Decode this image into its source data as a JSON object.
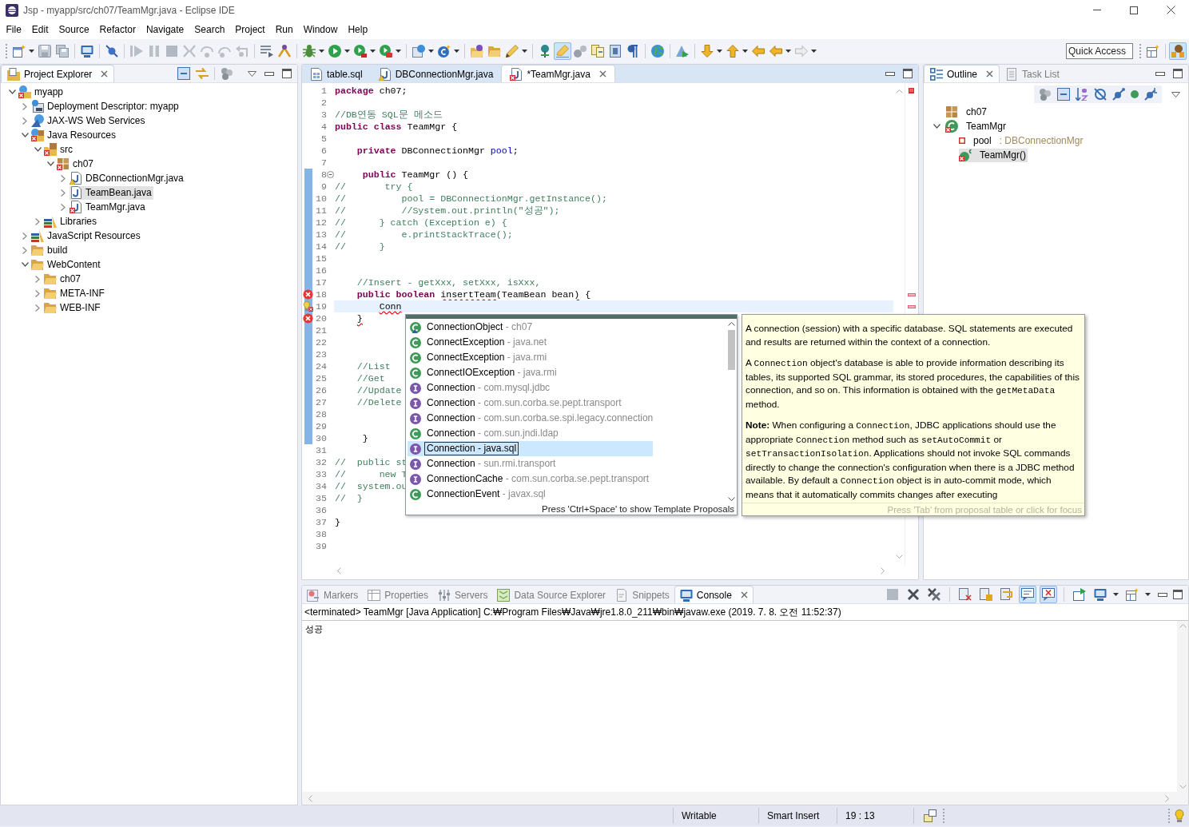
{
  "window": {
    "title": "Jsp - myapp/src/ch07/TeamMgr.java - Eclipse IDE"
  },
  "menu": [
    "File",
    "Edit",
    "Source",
    "Refactor",
    "Navigate",
    "Search",
    "Project",
    "Run",
    "Window",
    "Help"
  ],
  "main_toolbar": [
    {
      "kind": "new",
      "on": false,
      "menu": true
    },
    {
      "kind": "save",
      "on": false,
      "menu": false
    },
    {
      "kind": "save-all",
      "on": false,
      "menu": false
    },
    {
      "kind": "separator"
    },
    {
      "kind": "terminal",
      "on": false,
      "menu": false
    },
    {
      "kind": "separator"
    },
    {
      "kind": "skip-breakpoints",
      "on": false,
      "menu": false
    },
    {
      "kind": "separator"
    },
    {
      "kind": "resume",
      "on": false,
      "menu": false
    },
    {
      "kind": "suspend",
      "on": false,
      "menu": false
    },
    {
      "kind": "terminate",
      "on": false,
      "menu": false
    },
    {
      "kind": "disconnect",
      "on": false,
      "menu": false
    },
    {
      "kind": "step-into",
      "on": false,
      "menu": false
    },
    {
      "kind": "step-over",
      "on": false,
      "menu": false
    },
    {
      "kind": "step-return",
      "on": false,
      "menu": false
    },
    {
      "kind": "separator"
    },
    {
      "kind": "step-filters",
      "on": false,
      "menu": false
    },
    {
      "kind": "drop-to-frame",
      "on": false,
      "menu": false
    },
    {
      "kind": "separator"
    },
    {
      "kind": "debug",
      "on": false,
      "menu": true
    },
    {
      "kind": "run",
      "on": false,
      "menu": true
    },
    {
      "kind": "coverage",
      "on": false,
      "menu": true
    },
    {
      "kind": "external-tools",
      "on": false,
      "menu": true
    },
    {
      "kind": "separator"
    },
    {
      "kind": "new-server",
      "on": false,
      "menu": true
    },
    {
      "kind": "new-class",
      "on": false,
      "menu": true
    },
    {
      "kind": "separator"
    },
    {
      "kind": "open-type",
      "on": false,
      "menu": false
    },
    {
      "kind": "open-task",
      "on": false,
      "menu": false
    },
    {
      "kind": "ant",
      "on": false,
      "menu": true
    },
    {
      "kind": "separator"
    },
    {
      "kind": "pin",
      "on": false,
      "menu": false
    },
    {
      "kind": "mark-occurrences",
      "on": true,
      "menu": false
    },
    {
      "kind": "block-select",
      "on": false,
      "menu": false
    },
    {
      "kind": "compare",
      "on": false,
      "menu": false
    },
    {
      "kind": "document",
      "on": false,
      "menu": false
    },
    {
      "kind": "whitespace",
      "on": false,
      "menu": false
    },
    {
      "kind": "separator"
    },
    {
      "kind": "globe",
      "on": false,
      "menu": false
    },
    {
      "kind": "separator"
    },
    {
      "kind": "launch",
      "on": false,
      "menu": false
    },
    {
      "kind": "separator"
    },
    {
      "kind": "next-annotation",
      "on": false,
      "menu": true
    },
    {
      "kind": "prev-annotation",
      "on": false,
      "menu": true
    },
    {
      "kind": "last-edit",
      "on": false,
      "menu": false
    },
    {
      "kind": "back",
      "on": false,
      "menu": true
    },
    {
      "kind": "forward",
      "on": false,
      "menu": true
    }
  ],
  "quick_access": {
    "placeholder": "Quick Access"
  },
  "perspectives": [
    {
      "kind": "open-perspective",
      "on": false
    },
    {
      "kind": "java-ee",
      "on": true
    }
  ],
  "project_explorer": {
    "tabs": [
      {
        "label": "Project Explorer",
        "kind": "explorer",
        "selected": true
      }
    ],
    "tree": [
      {
        "label": "myapp",
        "kind": "project",
        "error": true,
        "warning": false,
        "expanded": true,
        "selected": false,
        "children": [
          {
            "label": "Deployment Descriptor: myapp",
            "kind": "descriptor",
            "error": false,
            "warning": false,
            "expanded": false,
            "selected": false
          },
          {
            "label": "JAX-WS Web Services",
            "kind": "webservices",
            "error": false,
            "warning": false,
            "expanded": false,
            "selected": false
          },
          {
            "label": "Java Resources",
            "kind": "java-resources",
            "error": true,
            "warning": false,
            "expanded": true,
            "selected": false,
            "children": [
              {
                "label": "src",
                "kind": "source-folder",
                "error": true,
                "warning": false,
                "expanded": true,
                "selected": false,
                "children": [
                  {
                    "label": "ch07",
                    "kind": "package",
                    "error": true,
                    "warning": false,
                    "expanded": true,
                    "selected": false,
                    "children": [
                      {
                        "label": "DBConnectionMgr.java",
                        "kind": "java-file",
                        "error": false,
                        "warning": true,
                        "expanded": false,
                        "selected": false
                      },
                      {
                        "label": "TeamBean.java",
                        "kind": "java-file",
                        "error": false,
                        "warning": false,
                        "expanded": false,
                        "selected": true
                      },
                      {
                        "label": "TeamMgr.java",
                        "kind": "java-file",
                        "error": true,
                        "warning": false,
                        "expanded": false,
                        "selected": false
                      }
                    ]
                  }
                ]
              },
              {
                "label": "Libraries",
                "kind": "library",
                "error": false,
                "warning": false,
                "expanded": false,
                "selected": false
              }
            ]
          },
          {
            "label": "JavaScript Resources",
            "kind": "library",
            "error": false,
            "warning": false,
            "expanded": false,
            "selected": false
          },
          {
            "label": "build",
            "kind": "folder",
            "error": false,
            "warning": false,
            "expanded": false,
            "selected": false
          },
          {
            "label": "WebContent",
            "kind": "folder",
            "error": false,
            "warning": false,
            "expanded": true,
            "selected": false,
            "children": [
              {
                "label": "ch07",
                "kind": "folder",
                "error": false,
                "warning": false,
                "expanded": false,
                "selected": false
              },
              {
                "label": "META-INF",
                "kind": "folder",
                "error": false,
                "warning": false,
                "expanded": false,
                "selected": false
              },
              {
                "label": "WEB-INF",
                "kind": "folder",
                "error": false,
                "warning": false,
                "expanded": false,
                "selected": false
              }
            ]
          }
        ]
      }
    ]
  },
  "editor": {
    "tabs": [
      {
        "label": "table.sql",
        "kind": "sql",
        "error": false,
        "warning": false,
        "selected": false
      },
      {
        "label": "DBConnectionMgr.java",
        "kind": "java-file",
        "error": false,
        "warning": true,
        "selected": false
      },
      {
        "label": "*TeamMgr.java",
        "kind": "java-file",
        "error": true,
        "warning": false,
        "selected": true
      }
    ],
    "lines": [
      {
        "number": "1",
        "kind": "plain",
        "current": false,
        "scope": false,
        "fold": false,
        "segments": [
          {
            "kind": "keyword",
            "text": "package"
          },
          {
            "kind": "plain",
            "text": " ch07;"
          }
        ]
      },
      {
        "number": "2",
        "kind": "plain",
        "current": false,
        "scope": false,
        "fold": false
      },
      {
        "number": "3",
        "kind": "plain",
        "current": false,
        "scope": false,
        "fold": false,
        "segments": [
          {
            "kind": "comment",
            "text": "//DB연동 SQL문 메소드"
          }
        ]
      },
      {
        "number": "4",
        "kind": "plain",
        "current": false,
        "scope": false,
        "fold": false,
        "segments": [
          {
            "kind": "keyword",
            "text": "public"
          },
          {
            "kind": "keyword",
            "text": " class"
          },
          {
            "kind": "plain",
            "text": " TeamMgr {"
          }
        ]
      },
      {
        "number": "5",
        "kind": "plain",
        "current": false,
        "scope": false,
        "fold": false
      },
      {
        "number": "6",
        "kind": "plain",
        "current": false,
        "scope": false,
        "fold": false,
        "segments": [
          {
            "kind": "keyword",
            "text": "    private"
          },
          {
            "kind": "plain",
            "text": " DBConnectionMgr "
          },
          {
            "kind": "field",
            "text": "pool"
          },
          {
            "kind": "plain",
            "text": ";"
          }
        ]
      },
      {
        "number": "7",
        "kind": "plain",
        "current": false,
        "scope": false,
        "fold": false
      },
      {
        "number": "8",
        "kind": "plain",
        "current": false,
        "scope": true,
        "fold": true,
        "segments": [
          {
            "kind": "keyword",
            "text": "     public"
          },
          {
            "kind": "plain",
            "text": " TeamMgr () {"
          }
        ]
      },
      {
        "number": "9",
        "kind": "plain",
        "current": false,
        "scope": true,
        "fold": false,
        "segments": [
          {
            "kind": "comment",
            "text": "//       try {"
          }
        ]
      },
      {
        "number": "10",
        "kind": "plain",
        "current": false,
        "scope": true,
        "fold": false,
        "segments": [
          {
            "kind": "comment",
            "text": "//          pool = DBConnectionMgr.getInstance();"
          }
        ]
      },
      {
        "number": "11",
        "kind": "plain",
        "current": false,
        "scope": true,
        "fold": false,
        "segments": [
          {
            "kind": "comment",
            "text": "//          //System.out.println(\"성공\");"
          }
        ]
      },
      {
        "number": "12",
        "kind": "plain",
        "current": false,
        "scope": true,
        "fold": false,
        "segments": [
          {
            "kind": "comment",
            "text": "//      } catch (Exception e) {"
          }
        ]
      },
      {
        "number": "13",
        "kind": "plain",
        "current": false,
        "scope": true,
        "fold": false,
        "segments": [
          {
            "kind": "comment",
            "text": "//          e.printStackTrace();"
          }
        ]
      },
      {
        "number": "14",
        "kind": "plain",
        "current": false,
        "scope": true,
        "fold": false,
        "segments": [
          {
            "kind": "comment",
            "text": "//      }"
          }
        ]
      },
      {
        "number": "15",
        "kind": "plain",
        "current": false,
        "scope": true,
        "fold": false
      },
      {
        "number": "16",
        "kind": "plain",
        "current": false,
        "scope": true,
        "fold": false
      },
      {
        "number": "17",
        "kind": "plain",
        "current": false,
        "scope": true,
        "fold": false,
        "segments": [
          {
            "kind": "comment",
            "text": "    //Insert - getXxx, setXxx, isXxx,"
          }
        ]
      },
      {
        "number": "18",
        "kind": "error",
        "current": false,
        "scope": true,
        "fold": false,
        "segments": [
          {
            "kind": "keyword",
            "text": "    public"
          },
          {
            "kind": "keyword",
            "text": " boolean"
          },
          {
            "kind": "error",
            "text": " insertTeam"
          },
          {
            "kind": "plain",
            "text": "(TeamBean bean"
          },
          {
            "kind": "error",
            "text": ")"
          },
          {
            "kind": "plain",
            "text": " {"
          }
        ]
      },
      {
        "number": "19",
        "kind": "quick-fix",
        "current": true,
        "scope": true,
        "fold": false,
        "segments": [
          {
            "kind": "error",
            "text": "        Conn"
          }
        ]
      },
      {
        "number": "20",
        "kind": "error",
        "current": false,
        "scope": true,
        "fold": false,
        "segments": [
          {
            "kind": "error",
            "text": "    }"
          }
        ]
      },
      {
        "number": "21",
        "kind": "plain",
        "current": false,
        "scope": true,
        "fold": false
      },
      {
        "number": "22",
        "kind": "plain",
        "current": false,
        "scope": true,
        "fold": false
      },
      {
        "number": "23",
        "kind": "plain",
        "current": false,
        "scope": true,
        "fold": false
      },
      {
        "number": "24",
        "kind": "plain",
        "current": false,
        "scope": true,
        "fold": false,
        "segments": [
          {
            "kind": "comment",
            "text": "    //List"
          }
        ]
      },
      {
        "number": "25",
        "kind": "plain",
        "current": false,
        "scope": true,
        "fold": false,
        "segments": [
          {
            "kind": "comment",
            "text": "    //Get"
          }
        ]
      },
      {
        "number": "26",
        "kind": "plain",
        "current": false,
        "scope": true,
        "fold": false,
        "segments": [
          {
            "kind": "comment",
            "text": "    //Update"
          }
        ]
      },
      {
        "number": "27",
        "kind": "plain",
        "current": false,
        "scope": true,
        "fold": false,
        "segments": [
          {
            "kind": "comment",
            "text": "    //Delete"
          }
        ]
      },
      {
        "number": "28",
        "kind": "plain",
        "current": false,
        "scope": true,
        "fold": false
      },
      {
        "number": "29",
        "kind": "plain",
        "current": false,
        "scope": true,
        "fold": false
      },
      {
        "number": "30",
        "kind": "plain",
        "current": false,
        "scope": true,
        "fold": false,
        "segments": [
          {
            "kind": "plain",
            "text": "     }"
          }
        ]
      },
      {
        "number": "31",
        "kind": "plain",
        "current": false,
        "scope": false,
        "fold": false
      },
      {
        "number": "32",
        "kind": "plain",
        "current": false,
        "scope": false,
        "fold": false,
        "segments": [
          {
            "kind": "comment",
            "text": "//  public st"
          }
        ]
      },
      {
        "number": "33",
        "kind": "plain",
        "current": false,
        "scope": false,
        "fold": false,
        "segments": [
          {
            "kind": "comment",
            "text": "//      new T"
          }
        ]
      },
      {
        "number": "34",
        "kind": "plain",
        "current": false,
        "scope": false,
        "fold": false,
        "segments": [
          {
            "kind": "comment",
            "text": "//  system.ou"
          }
        ]
      },
      {
        "number": "35",
        "kind": "plain",
        "current": false,
        "scope": false,
        "fold": false,
        "segments": [
          {
            "kind": "comment",
            "text": "//  }"
          }
        ]
      },
      {
        "number": "36",
        "kind": "plain",
        "current": false,
        "scope": false,
        "fold": false
      },
      {
        "number": "37",
        "kind": "plain",
        "current": false,
        "scope": false,
        "fold": false,
        "segments": [
          {
            "kind": "plain",
            "text": "}"
          }
        ]
      },
      {
        "number": "38",
        "kind": "plain",
        "current": false,
        "scope": false,
        "fold": false
      },
      {
        "number": "39",
        "kind": "plain",
        "current": false,
        "scope": false,
        "fold": false
      }
    ]
  },
  "content_assist": {
    "proposals": [
      {
        "kind": "package-class",
        "label": "ConnectionObject",
        "qualifier": "- ch07",
        "selected": false
      },
      {
        "kind": "class",
        "label": "ConnectException",
        "qualifier": "- java.net",
        "selected": false
      },
      {
        "kind": "class",
        "label": "ConnectException",
        "qualifier": "- java.rmi",
        "selected": false
      },
      {
        "kind": "class",
        "label": "ConnectIOException",
        "qualifier": "- java.rmi",
        "selected": false
      },
      {
        "kind": "interface",
        "label": "Connection",
        "qualifier": "- com.mysql.jdbc",
        "selected": false
      },
      {
        "kind": "interface",
        "label": "Connection",
        "qualifier": "- com.sun.corba.se.pept.transport",
        "selected": false
      },
      {
        "kind": "interface",
        "label": "Connection",
        "qualifier": "- com.sun.corba.se.spi.legacy.connection",
        "selected": false
      },
      {
        "kind": "class",
        "label": "Connection",
        "qualifier": "- com.sun.jndi.ldap",
        "selected": false
      },
      {
        "kind": "interface",
        "label": "Connection",
        "qualifier": "- java.sql",
        "selected": true
      },
      {
        "kind": "interface",
        "label": "Connection",
        "qualifier": "- sun.rmi.transport",
        "selected": false
      },
      {
        "kind": "interface",
        "label": "ConnectionCache",
        "qualifier": "- com.sun.corba.se.pept.transport",
        "selected": false
      },
      {
        "kind": "class",
        "label": "ConnectionEvent",
        "qualifier": "- javax.sql",
        "selected": false
      }
    ],
    "hint": "Press 'Ctrl+Space' to show Template Proposals"
  },
  "javadoc": {
    "paragraphs": [
      [
        {
          "kind": "text",
          "text": "A connection (session) with a specific database. SQL statements are executed and results are returned within the context of a connection."
        }
      ],
      [
        {
          "kind": "text",
          "text": "A "
        },
        {
          "kind": "code",
          "text": "Connection"
        },
        {
          "kind": "text",
          "text": " object's database is able to provide information describing its tables, its supported SQL grammar, its stored procedures, the capabilities of this connection, and so on. This information is obtained with the "
        },
        {
          "kind": "code",
          "text": "getMetaData"
        },
        {
          "kind": "text",
          "text": " method."
        }
      ],
      [
        {
          "kind": "bold",
          "text": "Note:"
        },
        {
          "kind": "text",
          "text": " When configuring a "
        },
        {
          "kind": "code",
          "text": "Connection"
        },
        {
          "kind": "text",
          "text": ", JDBC applications should use the appropriate "
        },
        {
          "kind": "code",
          "text": "Connection"
        },
        {
          "kind": "text",
          "text": " method such as "
        },
        {
          "kind": "code",
          "text": "setAutoCommit"
        },
        {
          "kind": "text",
          "text": " or "
        },
        {
          "kind": "code",
          "text": "setTransactionIsolation"
        },
        {
          "kind": "text",
          "text": ". Applications should not invoke SQL commands directly to change the connection's configuration when there is a JDBC method available. By default a "
        },
        {
          "kind": "code",
          "text": "Connection"
        },
        {
          "kind": "text",
          "text": " object is in auto-commit mode, which means that it automatically commits changes after executing"
        }
      ]
    ],
    "hint": "Press 'Tab' from proposal table or click for focus"
  },
  "outline": {
    "tabs": [
      {
        "label": "Outline",
        "kind": "outline",
        "selected": true
      },
      {
        "label": "Task List",
        "kind": "tasklist",
        "selected": false
      }
    ],
    "tree": [
      {
        "label": "ch07",
        "kind": "package",
        "error": false,
        "warning": false,
        "selected": false
      },
      {
        "label": "TeamMgr",
        "kind": "class",
        "error": true,
        "warning": false,
        "expanded": true,
        "selected": false,
        "children": [
          {
            "label": "pool",
            "type": ": DBConnectionMgr",
            "kind": "private-field",
            "error": false,
            "warning": false,
            "selected": false
          },
          {
            "label": "TeamMgr()",
            "kind": "constructor",
            "error": true,
            "warning": false,
            "selected": true
          }
        ]
      }
    ]
  },
  "console": {
    "tabs": [
      {
        "label": "Markers",
        "kind": "markers",
        "selected": false
      },
      {
        "label": "Properties",
        "kind": "properties",
        "selected": false
      },
      {
        "label": "Servers",
        "kind": "servers",
        "selected": false
      },
      {
        "label": "Data Source Explorer",
        "kind": "datasource",
        "selected": false
      },
      {
        "label": "Snippets",
        "kind": "snippets",
        "selected": false
      },
      {
        "label": "Console",
        "kind": "console",
        "selected": true
      }
    ],
    "toolbar": [
      {
        "kind": "c-terminate",
        "on": false,
        "menu": false
      },
      {
        "kind": "c-remove",
        "on": false,
        "menu": false
      },
      {
        "kind": "c-remove-all",
        "on": false,
        "menu": false
      },
      {
        "kind": "separator"
      },
      {
        "kind": "c-clear",
        "on": false,
        "menu": false
      },
      {
        "kind": "c-scroll-lock",
        "on": false,
        "menu": false
      },
      {
        "kind": "c-word-wrap",
        "on": false,
        "menu": false
      },
      {
        "kind": "c-show-out",
        "on": true,
        "menu": false
      },
      {
        "kind": "c-show-err",
        "on": true,
        "menu": false
      },
      {
        "kind": "separator"
      },
      {
        "kind": "c-pin",
        "on": false,
        "menu": false
      },
      {
        "kind": "c-display",
        "on": false,
        "menu": true
      },
      {
        "kind": "c-open",
        "on": false,
        "menu": true
      }
    ],
    "process": "<terminated> TeamMgr [Java Application] C:₩Program Files₩Java₩jre1.8.0_211₩bin₩javaw.exe (2019. 7. 8. 오전 11:52:37)",
    "output": "성공"
  },
  "status_bar": {
    "items": [
      "Writable",
      "Smart Insert",
      "19 : 13"
    ]
  }
}
